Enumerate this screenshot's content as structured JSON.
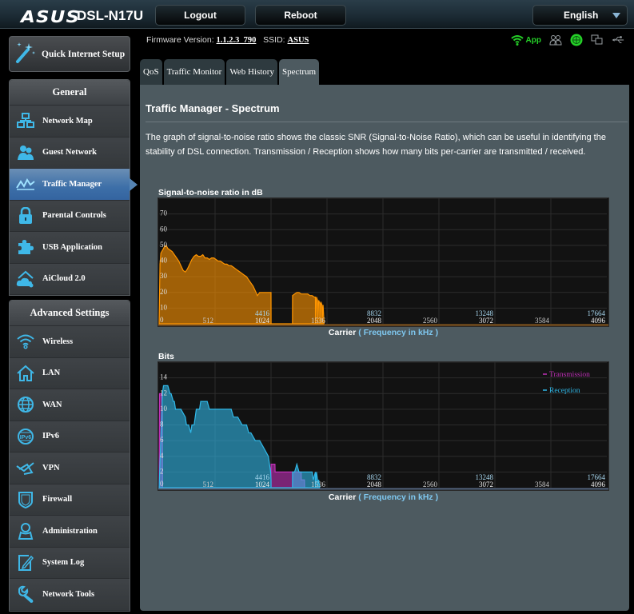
{
  "header": {
    "brand": "ASUS",
    "model": "DSL-N17U",
    "logout_label": "Logout",
    "reboot_label": "Reboot",
    "language": "English"
  },
  "status_bar": {
    "firmware_label": "Firmware Version:",
    "firmware_value": "1.1.2.3_790",
    "ssid_label": "SSID:",
    "ssid_value": "ASUS",
    "app_label": "App",
    "icons": [
      "wifi-app-icon",
      "clients-icon",
      "internet-status-icon",
      "network-devices-icon",
      "usb-icon"
    ],
    "colors": {
      "app_green": "#25d128",
      "icon_gray": "#9aa0a4"
    }
  },
  "sidebar": {
    "quick_setup_label": "Quick Internet Setup",
    "general": {
      "title": "General",
      "items": [
        {
          "label": "Network Map",
          "icon": "network-map-icon"
        },
        {
          "label": "Guest Network",
          "icon": "guest-network-icon"
        },
        {
          "label": "Traffic Manager",
          "icon": "traffic-manager-icon",
          "active": true
        },
        {
          "label": "Parental Controls",
          "icon": "lock-icon"
        },
        {
          "label": "USB Application",
          "icon": "puzzle-icon"
        },
        {
          "label": "AiCloud 2.0",
          "icon": "cloud-home-icon"
        }
      ]
    },
    "advanced": {
      "title": "Advanced Settings",
      "items": [
        {
          "label": "Wireless",
          "icon": "wifi-icon"
        },
        {
          "label": "LAN",
          "icon": "house-icon"
        },
        {
          "label": "WAN",
          "icon": "globe-icon"
        },
        {
          "label": "IPv6",
          "icon": "ipv6-globe-icon"
        },
        {
          "label": "VPN",
          "icon": "vpn-icon"
        },
        {
          "label": "Firewall",
          "icon": "shield-icon"
        },
        {
          "label": "Administration",
          "icon": "admin-user-icon"
        },
        {
          "label": "System Log",
          "icon": "log-edit-icon"
        },
        {
          "label": "Network Tools",
          "icon": "wrench-icon"
        }
      ]
    },
    "accent_color": "#3fb8e8"
  },
  "tabs": [
    {
      "label": "QoS",
      "active": false
    },
    {
      "label": "Traffic Monitor",
      "active": false
    },
    {
      "label": "Web History",
      "active": false
    },
    {
      "label": "Spectrum",
      "active": true
    }
  ],
  "main": {
    "title": "Traffic Manager - Spectrum",
    "description": "The graph of signal-to-noise ratio shows the classic SNR (Signal-to-Noise Ratio), which can be useful in identifying the stability of DSL connection. Transmission / Reception shows how many bits per-carrier are transmitted / received.",
    "axis_title_carrier": "Carrier",
    "axis_title_freq": "( Frequency in kHz )"
  },
  "chart_data": [
    {
      "type": "area",
      "title": "Signal-to-noise ratio in dB",
      "xlabel": "Carrier ( Frequency in kHz )",
      "ylabel": "dB",
      "xlim": [
        0,
        4096
      ],
      "ylim": [
        0,
        80
      ],
      "grid": true,
      "y_ticks": [
        0,
        10,
        20,
        30,
        40,
        50,
        60,
        70
      ],
      "x_ticks_carrier": [
        "512",
        "1024",
        "1536",
        "2048",
        "2560",
        "3072",
        "3584",
        "4096"
      ],
      "x_ticks_freq": [
        {
          "carrier": 1024,
          "label": "4416"
        },
        {
          "carrier": 2048,
          "label": "8832"
        },
        {
          "carrier": 3072,
          "label": "13248"
        },
        {
          "carrier": 4096,
          "label": "17664"
        }
      ],
      "series": [
        {
          "name": "SNR",
          "color": "#ff9500",
          "x": [
            0,
            8,
            16,
            32,
            48,
            64,
            80,
            100,
            120,
            140,
            160,
            180,
            200,
            220,
            240,
            260,
            280,
            300,
            320,
            340,
            360,
            380,
            400,
            420,
            440,
            460,
            480,
            500,
            520,
            540,
            560,
            580,
            600,
            620,
            640,
            660,
            680,
            700,
            720,
            740,
            760,
            780,
            800,
            820,
            840,
            860,
            880,
            900,
            920,
            940,
            960,
            980,
            1000,
            1010,
            1020,
            1024,
            1025,
            1220,
            1221,
            1240,
            1260,
            1280,
            1300,
            1320,
            1340,
            1360,
            1380,
            1400,
            1420,
            1430,
            1431,
            1440,
            1450,
            1451,
            1460,
            1470,
            1471,
            1480,
            1490,
            1491,
            1500,
            1510
          ],
          "values": [
            0,
            38,
            45,
            47,
            49,
            50,
            48,
            47,
            46,
            44,
            42,
            40,
            37,
            34,
            33,
            35,
            38,
            41,
            43,
            44,
            43,
            43,
            44,
            42,
            42,
            41,
            42,
            42,
            41,
            40,
            40,
            39,
            38,
            38,
            37,
            37,
            36,
            35,
            34,
            33,
            32,
            31,
            30,
            28,
            26,
            24,
            21,
            18,
            20,
            20,
            20,
            20,
            20,
            20,
            20,
            20,
            0,
            0,
            18,
            19,
            20,
            20,
            19,
            19,
            19,
            19,
            18,
            18,
            17,
            17,
            0,
            17,
            15,
            0,
            15,
            13,
            0,
            14,
            12,
            0,
            12,
            0
          ]
        }
      ]
    },
    {
      "type": "area",
      "title": "Bits",
      "xlabel": "Carrier ( Frequency in kHz )",
      "ylabel": "Bits",
      "xlim": [
        0,
        4096
      ],
      "ylim": [
        0,
        16
      ],
      "grid": true,
      "y_ticks": [
        0,
        2,
        4,
        6,
        8,
        10,
        12,
        14
      ],
      "x_ticks_carrier": [
        "512",
        "1024",
        "1536",
        "2048",
        "2560",
        "3072",
        "3584",
        "4096"
      ],
      "x_ticks_freq": [
        {
          "carrier": 1024,
          "label": "4416"
        },
        {
          "carrier": 2048,
          "label": "8832"
        },
        {
          "carrier": 3072,
          "label": "13248"
        },
        {
          "carrier": 4096,
          "label": "17664"
        }
      ],
      "legend": {
        "placement": "top-right",
        "entries": [
          "Transmission",
          "Reception"
        ]
      },
      "series": [
        {
          "name": "Transmission",
          "color": "#c030b8",
          "x": [
            0,
            4,
            20,
            30,
            32,
            1024,
            1025,
            1060,
            1061,
            1300,
            1301,
            1330,
            1331,
            1360
          ],
          "values": [
            0,
            12,
            12,
            10,
            0,
            0,
            3,
            3,
            2,
            2,
            1,
            1,
            0,
            0
          ]
        },
        {
          "name": "Reception",
          "color": "#30b8e8",
          "x": [
            0,
            30,
            40,
            60,
            80,
            100,
            110,
            130,
            140,
            150,
            200,
            240,
            250,
            270,
            290,
            300,
            320,
            340,
            360,
            370,
            380,
            400,
            420,
            440,
            460,
            480,
            500,
            540,
            560,
            580,
            620,
            640,
            660,
            680,
            700,
            720,
            760,
            800,
            820,
            840,
            880,
            900,
            920,
            960,
            1000,
            1010,
            1020,
            1024,
            1025,
            1220,
            1221,
            1240,
            1260,
            1280,
            1300,
            1360,
            1380,
            1400,
            1410,
            1430,
            1431,
            1440,
            1450,
            1451,
            1460,
            1470,
            1471
          ],
          "values": [
            0,
            12,
            13,
            13,
            13,
            12,
            12,
            11,
            11,
            10,
            10,
            9,
            8,
            8,
            7,
            8,
            8,
            10,
            10,
            10,
            11,
            11,
            11,
            11,
            10,
            10,
            10,
            10,
            10,
            10,
            10,
            10,
            10,
            9,
            9,
            9,
            8,
            8,
            7,
            7,
            6,
            6,
            6,
            5,
            4,
            3,
            2,
            1,
            0,
            0,
            2,
            2,
            3,
            2,
            2,
            2,
            2,
            2,
            1,
            2,
            0,
            2,
            1,
            0,
            1,
            0,
            0
          ]
        }
      ]
    }
  ]
}
